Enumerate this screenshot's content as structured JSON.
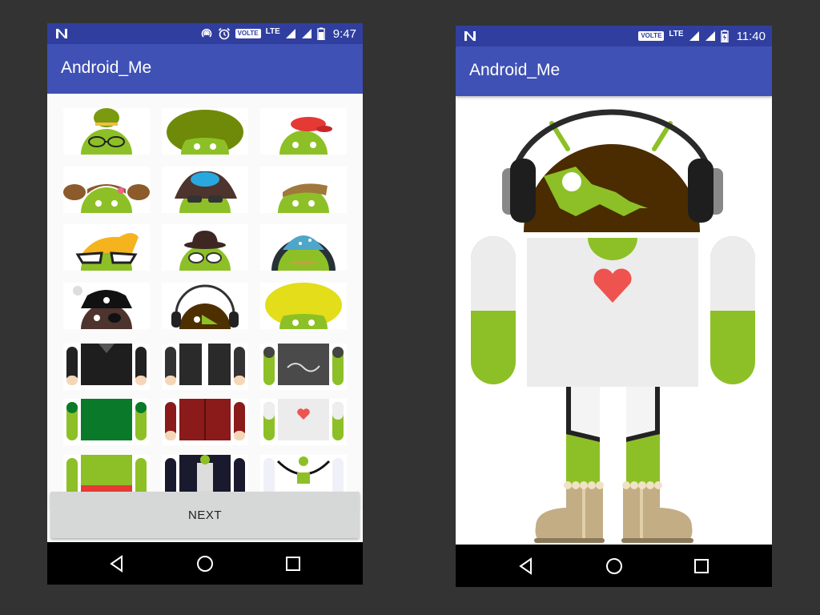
{
  "left_screen": {
    "status_bar": {
      "time": "9:47",
      "network": "LTE",
      "volte": "VOLTE",
      "icons": [
        "notification-n-icon",
        "hotspot-icon",
        "alarm-icon",
        "volte-icon",
        "signal-icon",
        "wifi-icon",
        "battery-icon"
      ]
    },
    "app_bar": {
      "title": "Android_Me"
    },
    "grid": {
      "items": [
        {
          "type": "head",
          "name": "head-glasses-bun"
        },
        {
          "type": "head",
          "name": "head-green-afro"
        },
        {
          "type": "head",
          "name": "head-red-cap"
        },
        {
          "type": "head",
          "name": "head-pigtails"
        },
        {
          "type": "head",
          "name": "head-blue-cap-sunglasses"
        },
        {
          "type": "head",
          "name": "head-brown-hair"
        },
        {
          "type": "head",
          "name": "head-blonde-cat-glasses"
        },
        {
          "type": "head",
          "name": "head-bowler-hat"
        },
        {
          "type": "head",
          "name": "head-wizard-hat"
        },
        {
          "type": "head",
          "name": "head-pirate"
        },
        {
          "type": "head",
          "name": "head-headphones"
        },
        {
          "type": "head",
          "name": "head-yellow-afro"
        },
        {
          "type": "body",
          "name": "body-black-coat"
        },
        {
          "type": "body",
          "name": "body-black-jacket"
        },
        {
          "type": "body",
          "name": "body-gray-graffiti"
        },
        {
          "type": "body",
          "name": "body-green-shirt"
        },
        {
          "type": "body",
          "name": "body-red-jacket"
        },
        {
          "type": "body",
          "name": "body-white-heart"
        },
        {
          "type": "body",
          "name": "body-green-red-belt"
        },
        {
          "type": "body",
          "name": "body-black-stars"
        },
        {
          "type": "body",
          "name": "body-white-overalls"
        }
      ]
    },
    "next_button": {
      "label": "NEXT"
    }
  },
  "right_screen": {
    "status_bar": {
      "time": "11:40",
      "network": "LTE",
      "volte": "VOLTE",
      "icons": [
        "notification-n-icon",
        "volte-icon",
        "signal-icon",
        "wifi-icon",
        "battery-icon"
      ]
    },
    "app_bar": {
      "title": "Android_Me"
    }
  },
  "colors": {
    "android_green": "#8dc026",
    "status_bar": "#303f9f",
    "app_bar": "#3f51b5",
    "background": "#333333"
  }
}
